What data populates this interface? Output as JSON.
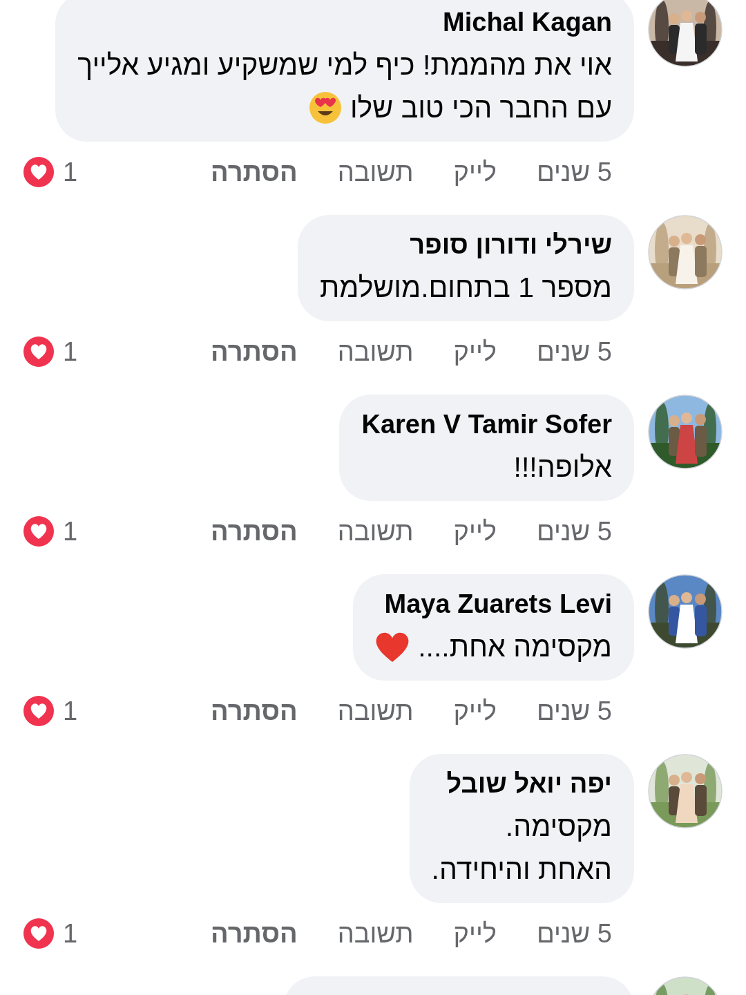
{
  "comments": [
    {
      "author": "Michal Kagan",
      "lines": [
        "אוי את מהממת! כיף למי שמשקיע ומגיע אלייך",
        "עם החבר הכי טוב שלו"
      ],
      "emoji": {
        "kind": "heart_eyes"
      },
      "avatar": {
        "kind": "picture"
      },
      "actions": {
        "time": "5 שנים",
        "like": "לייק",
        "reply": "תשובה",
        "hide": "הסתרה"
      },
      "reactions": {
        "kind": "love",
        "count": "1"
      }
    },
    {
      "author": "שירלי ודורון סופר",
      "lines": [
        "מספר 1 בתחום.מושלמת"
      ],
      "avatar": {
        "kind": "picture"
      },
      "actions": {
        "time": "5 שנים",
        "like": "לייק",
        "reply": "תשובה",
        "hide": "הסתרה"
      },
      "reactions": {
        "kind": "love",
        "count": "1"
      }
    },
    {
      "author": "Karen V Tamir Sofer",
      "lines": [
        "אלופה!!!"
      ],
      "avatar": {
        "kind": "picture"
      },
      "actions": {
        "time": "5 שנים",
        "like": "לייק",
        "reply": "תשובה",
        "hide": "הסתרה"
      },
      "reactions": {
        "kind": "love",
        "count": "1"
      }
    },
    {
      "author": "Maya Zuarets Levi",
      "lines": [
        "מקסימה אחת...."
      ],
      "emoji": {
        "kind": "red_heart"
      },
      "avatar": {
        "kind": "picture"
      },
      "actions": {
        "time": "5 שנים",
        "like": "לייק",
        "reply": "תשובה",
        "hide": "הסתרה"
      },
      "reactions": {
        "kind": "love",
        "count": "1"
      }
    },
    {
      "author": "יפה יואל שובל",
      "lines": [
        "מקסימה.",
        "האחת והיחידה."
      ],
      "avatar": {
        "kind": "picture"
      },
      "actions": {
        "time": "5 שנים",
        "like": "לייק",
        "reply": "תשובה",
        "hide": "הסתרה"
      },
      "reactions": {
        "kind": "love",
        "count": "1"
      }
    }
  ],
  "next_comment": {
    "visible": true,
    "avatar": {
      "kind": "picture"
    }
  }
}
